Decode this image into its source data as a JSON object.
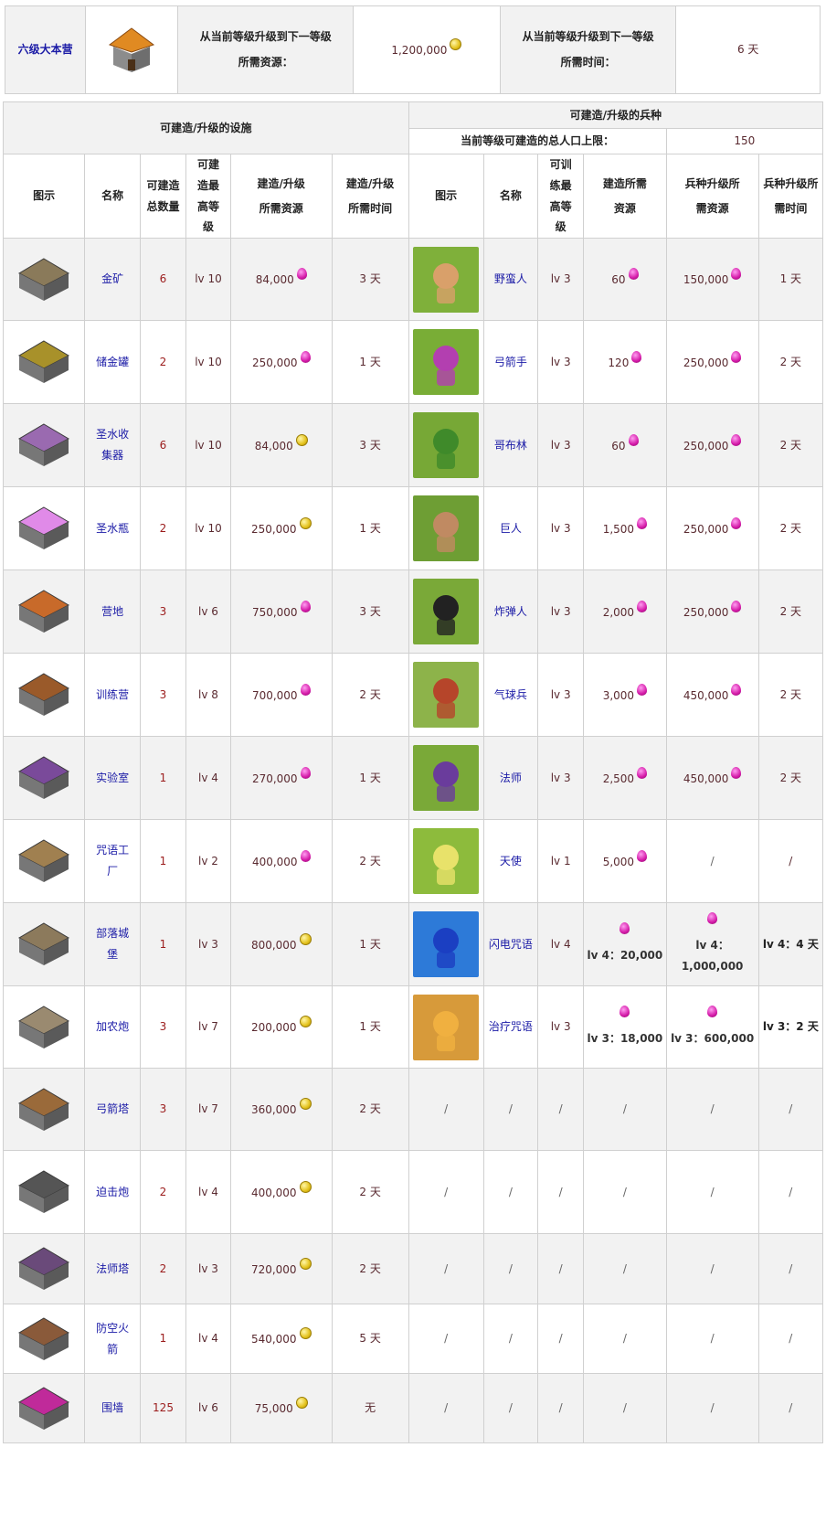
{
  "header": {
    "th_name": "六级大本营",
    "res_label": "从当前等级升级到下一等级所需资源：",
    "res_value": "1,200,000",
    "time_label": "从当前等级升级到下一等级所需时间：",
    "time_value": "6 天"
  },
  "left": {
    "title": "可建造/升级的设施",
    "cols": [
      "图示",
      "名称",
      "可建造总数量",
      "可建造最高等级",
      "建造/升级所需资源",
      "建造/升级所需时间"
    ]
  },
  "right": {
    "title": "可建造/升级的兵种",
    "pop_label": "当前等级可建造的总人口上限：",
    "pop_value": "150",
    "cols": [
      "图示",
      "名称",
      "可训练最高等级",
      "建造所需资源",
      "兵种升级所需资源",
      "兵种升级所需时间"
    ]
  },
  "buildings": [
    {
      "icon": "gold-mine-icon",
      "name": "金矿",
      "count": "6",
      "level": "lv 10",
      "cost": "84,000",
      "res": "elixir",
      "time": "3 天"
    },
    {
      "icon": "gold-storage-icon",
      "name": "储金罐",
      "count": "2",
      "level": "lv 10",
      "cost": "250,000",
      "res": "elixir",
      "time": "1 天"
    },
    {
      "icon": "elixir-collector-icon",
      "name": "圣水收集器",
      "count": "6",
      "level": "lv 10",
      "cost": "84,000",
      "res": "gold",
      "time": "3 天"
    },
    {
      "icon": "elixir-storage-icon",
      "name": "圣水瓶",
      "count": "2",
      "level": "lv 10",
      "cost": "250,000",
      "res": "gold",
      "time": "1 天"
    },
    {
      "icon": "army-camp-icon",
      "name": "营地",
      "count": "3",
      "level": "lv 6",
      "cost": "750,000",
      "res": "elixir",
      "time": "3 天"
    },
    {
      "icon": "barracks-icon",
      "name": "训练营",
      "count": "3",
      "level": "lv 8",
      "cost": "700,000",
      "res": "elixir",
      "time": "2 天"
    },
    {
      "icon": "laboratory-icon",
      "name": "实验室",
      "count": "1",
      "level": "lv 4",
      "cost": "270,000",
      "res": "elixir",
      "time": "1 天"
    },
    {
      "icon": "spell-factory-icon",
      "name": "咒语工厂",
      "count": "1",
      "level": "lv 2",
      "cost": "400,000",
      "res": "elixir",
      "time": "2 天"
    },
    {
      "icon": "clan-castle-icon",
      "name": "部落城堡",
      "count": "1",
      "level": "lv 3",
      "cost": "800,000",
      "res": "gold",
      "time": "1 天"
    },
    {
      "icon": "cannon-icon",
      "name": "加农炮",
      "count": "3",
      "level": "lv 7",
      "cost": "200,000",
      "res": "gold",
      "time": "1 天"
    },
    {
      "icon": "archer-tower-icon",
      "name": "弓箭塔",
      "count": "3",
      "level": "lv 7",
      "cost": "360,000",
      "res": "gold",
      "time": "2 天"
    },
    {
      "icon": "mortar-icon",
      "name": "迫击炮",
      "count": "2",
      "level": "lv 4",
      "cost": "400,000",
      "res": "gold",
      "time": "2 天"
    },
    {
      "icon": "wizard-tower-icon",
      "name": "法师塔",
      "count": "2",
      "level": "lv 3",
      "cost": "720,000",
      "res": "gold",
      "time": "2 天"
    },
    {
      "icon": "air-defense-icon",
      "name": "防空火箭",
      "count": "1",
      "level": "lv 4",
      "cost": "540,000",
      "res": "gold",
      "time": "5 天"
    },
    {
      "icon": "wall-icon",
      "name": "围墙",
      "count": "125",
      "level": "lv 6",
      "cost": "75,000",
      "res": "gold",
      "time": "无"
    }
  ],
  "troops": [
    {
      "icon": "barbarian-icon",
      "name": "野蛮人",
      "level": "lv 3",
      "build": "60",
      "upgrade": "150,000",
      "time": "1 天",
      "bg": "#7fb03a",
      "fg": "#d9a06a"
    },
    {
      "icon": "archer-icon",
      "name": "弓箭手",
      "level": "lv 3",
      "build": "120",
      "upgrade": "250,000",
      "time": "2 天",
      "bg": "#79ad36",
      "fg": "#b33fb0"
    },
    {
      "icon": "goblin-icon",
      "name": "哥布林",
      "level": "lv 3",
      "build": "60",
      "upgrade": "250,000",
      "time": "2 天",
      "bg": "#77a836",
      "fg": "#3f8a2a"
    },
    {
      "icon": "giant-icon",
      "name": "巨人",
      "level": "lv 3",
      "build": "1,500",
      "upgrade": "250,000",
      "time": "2 天",
      "bg": "#6e9e34",
      "fg": "#c08a62"
    },
    {
      "icon": "wall-breaker-icon",
      "name": "炸弹人",
      "level": "lv 3",
      "build": "2,000",
      "upgrade": "250,000",
      "time": "2 天",
      "bg": "#7aa938",
      "fg": "#222222"
    },
    {
      "icon": "balloon-icon",
      "name": "气球兵",
      "level": "lv 3",
      "build": "3,000",
      "upgrade": "450,000",
      "time": "2 天",
      "bg": "#8db34a",
      "fg": "#b6452a"
    },
    {
      "icon": "wizard-icon",
      "name": "法师",
      "level": "lv 3",
      "build": "2,500",
      "upgrade": "450,000",
      "time": "2 天",
      "bg": "#7aa938",
      "fg": "#6a3c9c"
    },
    {
      "icon": "healer-icon",
      "name": "天使",
      "level": "lv 1",
      "build": "5,000",
      "upgrade": "/",
      "time": "/",
      "bg": "#8dbb3c",
      "fg": "#e8e26a"
    },
    {
      "icon": "lightning-spell-icon",
      "name": "闪电咒语",
      "level": "lv 4",
      "build": "lv 4：20,000",
      "upgrade": "lv 4：1,000,000",
      "time": "lv 4：4 天",
      "bg": "#2d7ad8",
      "fg": "#1b3fc2"
    },
    {
      "icon": "healing-spell-icon",
      "name": "治疗咒语",
      "level": "lv 3",
      "build": "lv 3：18,000",
      "upgrade": "lv 3：600,000",
      "time": "lv 3：2 天",
      "bg": "#d79a3a",
      "fg": "#f0b040"
    }
  ],
  "empty": "/"
}
